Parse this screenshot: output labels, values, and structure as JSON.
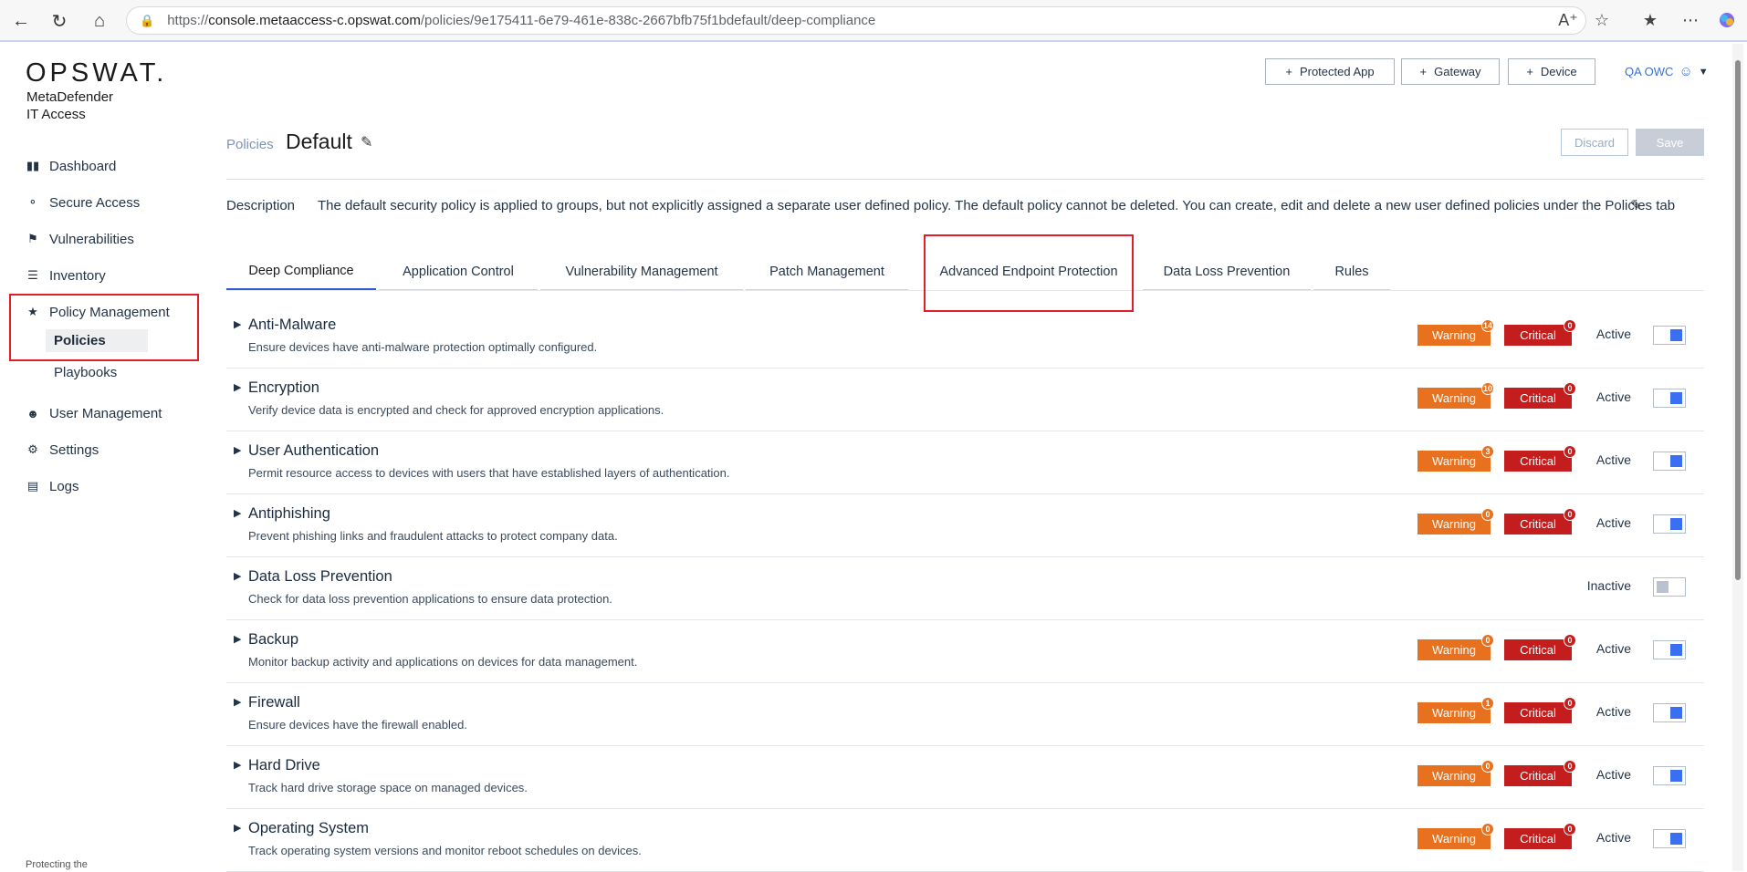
{
  "browser": {
    "url_prefix": "https://",
    "url_host": "console.metaaccess-c.opswat.com",
    "url_path": "/policies/9e175411-6e79-461e-838c-2667bfb75f1bdefault/deep-compliance"
  },
  "sidebar": {
    "logo": "OPSWAT.",
    "product_line1": "MetaDefender",
    "product_line2": "IT Access",
    "items": [
      {
        "label": "Dashboard",
        "icon": "bar-chart-icon"
      },
      {
        "label": "Secure Access",
        "icon": "key-icon"
      },
      {
        "label": "Vulnerabilities",
        "icon": "flag-icon"
      },
      {
        "label": "Inventory",
        "icon": "list-icon"
      },
      {
        "label": "Policy Management",
        "icon": "star-icon"
      },
      {
        "label": "User Management",
        "icon": "users-icon"
      },
      {
        "label": "Settings",
        "icon": "gear-icon"
      },
      {
        "label": "Logs",
        "icon": "clipboard-icon"
      }
    ],
    "sub_policies": "Policies",
    "sub_playbooks": "Playbooks",
    "footer": "Protecting the"
  },
  "header": {
    "protected_app": "Protected App",
    "gateway": "Gateway",
    "device": "Device",
    "user": "QA OWC"
  },
  "title": {
    "crumb": "Policies",
    "name": "Default",
    "discard": "Discard",
    "save": "Save"
  },
  "description": {
    "label": "Description",
    "text": "The default security policy is applied to groups, but not explicitly assigned a separate user defined policy. The default policy cannot be deleted. You can create, edit and delete a new user defined policies under the Policies tab"
  },
  "tabs": [
    "Deep Compliance",
    "Application Control",
    "Vulnerability Management",
    "Patch Management",
    "Advanced Endpoint Protection",
    "Data Loss Prevention",
    "Rules"
  ],
  "badges": {
    "warning": "Warning",
    "critical": "Critical"
  },
  "rows": [
    {
      "name": "Anti-Malware",
      "sub": "Ensure devices have anti-malware protection optimally configured.",
      "warn": "14",
      "crit": "0",
      "state": "Active"
    },
    {
      "name": "Encryption",
      "sub": "Verify device data is encrypted and check for approved encryption applications.",
      "warn": "10",
      "crit": "0",
      "state": "Active"
    },
    {
      "name": "User Authentication",
      "sub": "Permit resource access to devices with users that have established layers of authentication.",
      "warn": "3",
      "crit": "0",
      "state": "Active"
    },
    {
      "name": "Antiphishing",
      "sub": "Prevent phishing links and fraudulent attacks to protect company data.",
      "warn": "0",
      "crit": "0",
      "state": "Active"
    },
    {
      "name": "Data Loss Prevention",
      "sub": "Check for data loss prevention applications to ensure data protection.",
      "warn": "",
      "crit": "",
      "state": "Inactive"
    },
    {
      "name": "Backup",
      "sub": "Monitor backup activity and applications on devices for data management.",
      "warn": "0",
      "crit": "0",
      "state": "Active"
    },
    {
      "name": "Firewall",
      "sub": "Ensure devices have the firewall enabled.",
      "warn": "1",
      "crit": "0",
      "state": "Active"
    },
    {
      "name": "Hard Drive",
      "sub": "Track hard drive storage space on managed devices.",
      "warn": "0",
      "crit": "0",
      "state": "Active"
    },
    {
      "name": "Operating System",
      "sub": "Track operating system versions and monitor reboot schedules on devices.",
      "warn": "0",
      "crit": "0",
      "state": "Active"
    }
  ]
}
